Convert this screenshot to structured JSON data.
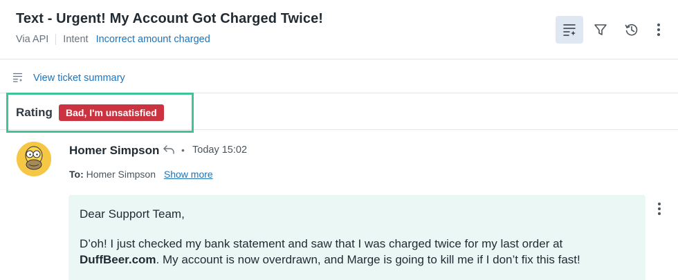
{
  "ticket": {
    "title": "Text - Urgent! My Account Got Charged Twice!",
    "channel": "Via API",
    "intent_label": "Intent",
    "intent_value": "Incorrect amount charged"
  },
  "header_actions": [
    {
      "icon": "summary-list-icon",
      "active": true
    },
    {
      "icon": "filter-icon",
      "active": false
    },
    {
      "icon": "history-icon",
      "active": false
    },
    {
      "icon": "more-vertical-icon",
      "active": false
    }
  ],
  "summary": {
    "link_label": "View ticket summary"
  },
  "rating": {
    "label": "Rating",
    "value": "Bad, I'm unsatisfied",
    "badge_color": "#cc3340",
    "highlight_color": "#3fc497"
  },
  "message": {
    "author": "Homer Simpson",
    "separator": "•",
    "timestamp": "Today 15:02",
    "to_label": "To:",
    "to_value": "Homer Simpson",
    "show_more": "Show more",
    "greeting": "Dear Support Team,",
    "body_line1": "D’oh! I just checked my bank statement and saw that I was charged twice for my last order at",
    "body_bold": "DuffBeer.com",
    "body_line2_rest": ". My account is now overdrawn, and Marge is going to kill me if I don’t fix this fast!",
    "bubble_color": "#eaf7f5"
  }
}
